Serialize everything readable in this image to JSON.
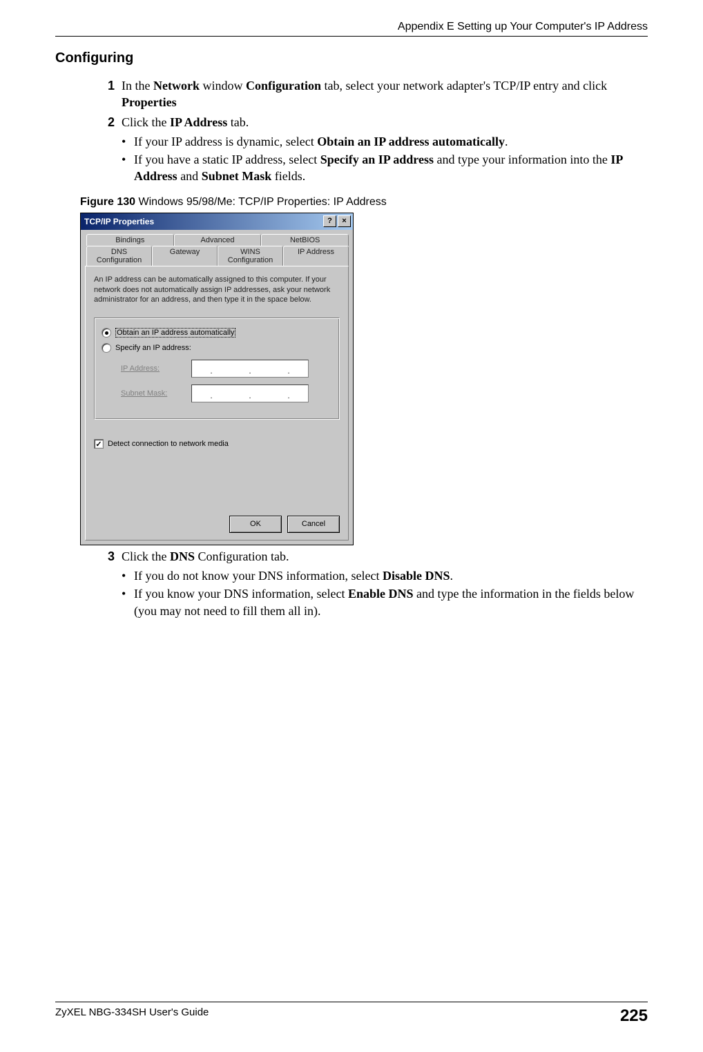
{
  "header": {
    "appendix": "Appendix E Setting up Your Computer's IP Address"
  },
  "section": {
    "title": "Configuring"
  },
  "steps": {
    "s1": {
      "num": "1",
      "t1": "In the ",
      "t2": "Network",
      "t3": " window ",
      "t4": "Configuration",
      "t5": " tab, select your network adapter's TCP/IP entry and click ",
      "t6": "Properties"
    },
    "s2": {
      "num": "2",
      "t1": "Click the ",
      "t2": "IP Address",
      "t3": " tab."
    },
    "s2b1": {
      "t1": "If your IP address is dynamic, select ",
      "t2": "Obtain an IP address automatically",
      "t3": "."
    },
    "s2b2": {
      "t1": "If you have a static IP address, select ",
      "t2": "Specify an IP address",
      "t3": " and type your information into the ",
      "t4": "IP Address",
      "t5": " and ",
      "t6": "Subnet Mask",
      "t7": " fields."
    },
    "s3": {
      "num": "3",
      "t1": "Click the ",
      "t2": "DNS",
      "t3": " Configuration tab."
    },
    "s3b1": {
      "t1": "If you do not know your DNS information, select ",
      "t2": "Disable DNS",
      "t3": "."
    },
    "s3b2": {
      "t1": "If you know your DNS information, select ",
      "t2": "Enable DNS",
      "t3": " and type the information in the fields below (you may not need to fill them all in)."
    }
  },
  "figure": {
    "label": "Figure 130",
    "caption": "   Windows 95/98/Me: TCP/IP Properties: IP Address"
  },
  "dialog": {
    "title": "TCP/IP Properties",
    "help_btn": "?",
    "close_btn": "×",
    "tabs_top": [
      "Bindings",
      "Advanced",
      "NetBIOS"
    ],
    "tabs_bot": [
      "DNS Configuration",
      "Gateway",
      "WINS Configuration",
      "IP Address"
    ],
    "active_tab": "IP Address",
    "desc": "An IP address can be automatically assigned to this computer. If your network does not automatically assign IP addresses, ask your network administrator for an address, and then type it in the space below.",
    "radio_obtain": "Obtain an IP address automatically",
    "radio_specify": "Specify an IP address:",
    "obtain_selected": true,
    "ip_label": "IP Address:",
    "subnet_label": "Subnet Mask:",
    "detect": "Detect connection to network media",
    "detect_checked": true,
    "ok": "OK",
    "cancel": "Cancel"
  },
  "footer": {
    "guide": "ZyXEL NBG-334SH User's Guide",
    "page": "225"
  }
}
